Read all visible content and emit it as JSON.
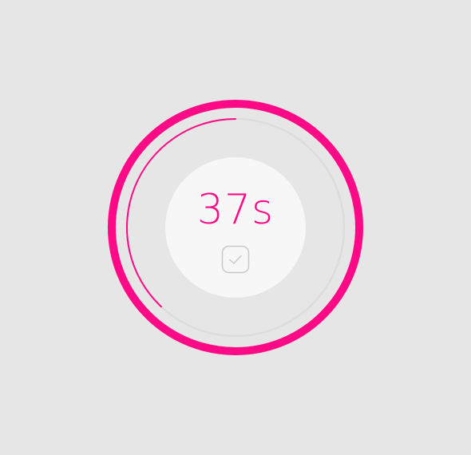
{
  "timer": {
    "display": "37s",
    "progress_fraction": 0.38,
    "check_icon": "check-icon"
  },
  "colors": {
    "background": "#e6e6e6",
    "accent": "#ff0a86",
    "track": "#dcdcdc",
    "inner_disc": "#f7f7f7",
    "check_icon": "#c8c8c8"
  }
}
